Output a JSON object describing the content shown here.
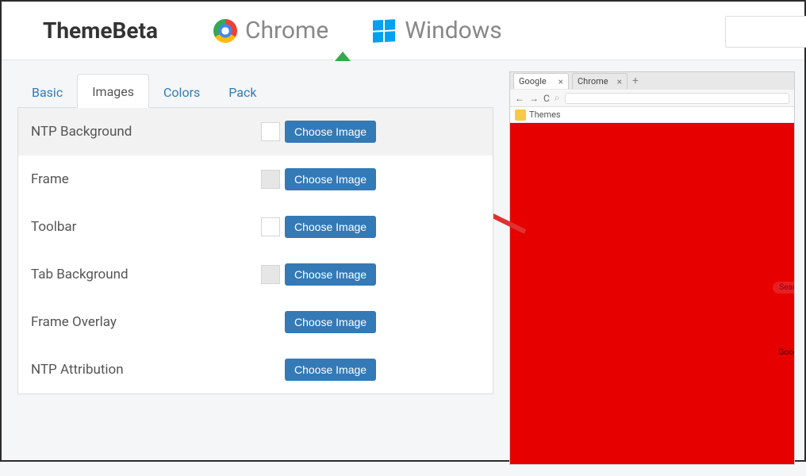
{
  "header": {
    "brand": "ThemeBeta",
    "nav": {
      "chrome": "Chrome",
      "windows": "Windows"
    }
  },
  "tabs": {
    "basic": "Basic",
    "images": "Images",
    "colors": "Colors",
    "pack": "Pack"
  },
  "rows": {
    "ntp_background": "NTP Background",
    "frame": "Frame",
    "toolbar": "Toolbar",
    "tab_background": "Tab Background",
    "frame_overlay": "Frame Overlay",
    "ntp_attribution": "NTP Attribution"
  },
  "button_label": "Choose Image",
  "preview": {
    "tab_google": "Google",
    "tab_chrome": "Chrome",
    "bookmark": "Themes",
    "google_label": "Google"
  }
}
